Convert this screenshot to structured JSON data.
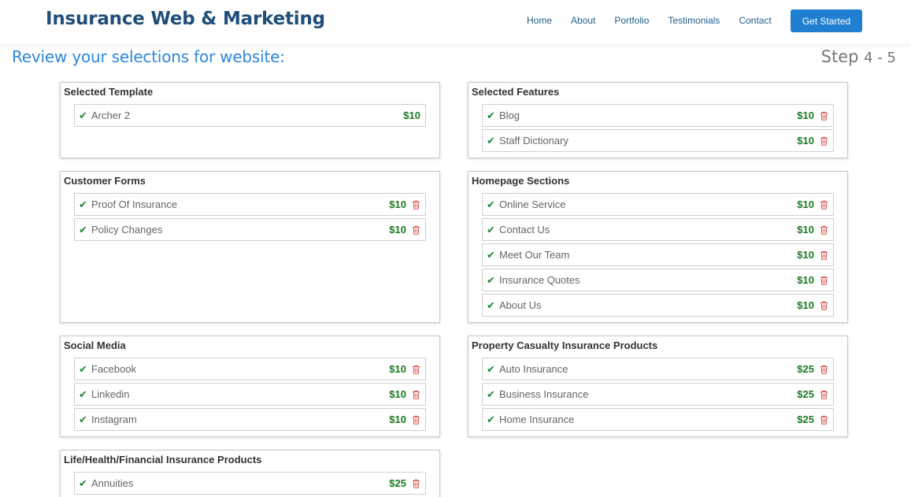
{
  "nav": {
    "brand": "Insurance Web & Marketing",
    "links": [
      "Home",
      "About",
      "Portfolio",
      "Testimonials",
      "Contact"
    ],
    "cta": "Get Started"
  },
  "page": {
    "title": "Review your selections for website:",
    "step_label": "Step",
    "step_value": "4 - 5"
  },
  "colors": {
    "accent": "#2e86de",
    "price": "#1b7a21",
    "check": "#1f8a34",
    "trash": "#d9534f"
  },
  "icons": {
    "check": "check-icon",
    "trash": "trash-icon"
  },
  "panels": {
    "template": {
      "title": "Selected Template",
      "items": [
        {
          "label": "Archer 2",
          "price": "$10"
        }
      ]
    },
    "features": {
      "title": "Selected Features",
      "items": [
        {
          "label": "Blog",
          "price": "$10"
        },
        {
          "label": "Staff Dictionary",
          "price": "$10"
        }
      ]
    },
    "forms": {
      "title": "Customer Forms",
      "items": [
        {
          "label": "Proof Of Insurance",
          "price": "$10"
        },
        {
          "label": "Policy Changes",
          "price": "$10"
        }
      ]
    },
    "homepage": {
      "title": "Homepage Sections",
      "items": [
        {
          "label": "Online Service",
          "price": "$10"
        },
        {
          "label": "Contact Us",
          "price": "$10"
        },
        {
          "label": "Meet Our Team",
          "price": "$10"
        },
        {
          "label": "Insurance Quotes",
          "price": "$10"
        },
        {
          "label": "About Us",
          "price": "$10"
        }
      ]
    },
    "social": {
      "title": "Social Media",
      "items": [
        {
          "label": "Facebook",
          "price": "$10"
        },
        {
          "label": "Linkedin",
          "price": "$10"
        },
        {
          "label": "Instagram",
          "price": "$10"
        }
      ]
    },
    "property": {
      "title": "Property Casualty Insurance Products",
      "items": [
        {
          "label": "Auto Insurance",
          "price": "$25"
        },
        {
          "label": "Business Insurance",
          "price": "$25"
        },
        {
          "label": "Home Insurance",
          "price": "$25"
        }
      ]
    },
    "life": {
      "title": "Life/Health/Financial Insurance Products",
      "items": [
        {
          "label": "Annuities",
          "price": "$25"
        }
      ]
    }
  }
}
